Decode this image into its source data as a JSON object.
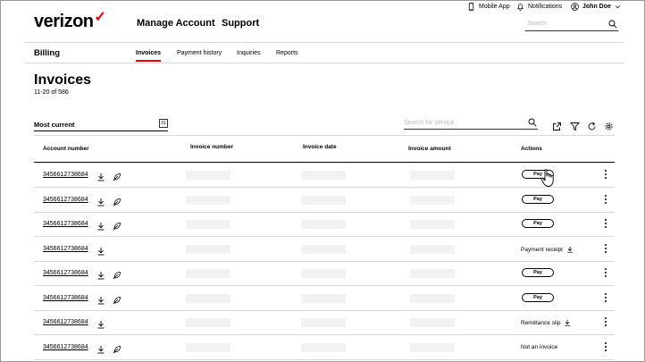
{
  "header": {
    "logo": "verizon",
    "logo_mark": "✓",
    "nav": [
      "Manage Account",
      "Support"
    ],
    "utility": {
      "mobile_app": "Mobile App",
      "notifications": "Notifications",
      "user": "John Doe"
    },
    "search_placeholder": "Search"
  },
  "subnav": {
    "section": "Billing",
    "tabs": [
      "Invoices",
      "Payment history",
      "Inquiries",
      "Reports"
    ],
    "active_tab": "Invoices"
  },
  "page": {
    "title": "Invoices",
    "count": "11-20 of 586"
  },
  "filters": {
    "sort_label": "Most current",
    "search_placeholder": "Search for service"
  },
  "table": {
    "columns": [
      "Account number",
      "Invoice number",
      "Invoice date",
      "Invoice amount",
      "Actions"
    ],
    "rows": [
      {
        "account": "3456612738684",
        "action": "Pay"
      },
      {
        "account": "3456612738684",
        "action": "Pay"
      },
      {
        "account": "3456612738684",
        "action": "Pay"
      },
      {
        "account": "3456612738684",
        "action": "Payment receipt"
      },
      {
        "account": "3456612738684",
        "action": "Pay"
      },
      {
        "account": "3456612738684",
        "action": "Pay"
      },
      {
        "account": "3456612738684",
        "action": "Remittance slip"
      },
      {
        "account": "3456612738684",
        "action": "Not an invoice"
      }
    ]
  },
  "colors": {
    "brand_red": "#ee0000",
    "divider": "#d8d8d8",
    "placeholder_bar": "#f2f2f2"
  }
}
